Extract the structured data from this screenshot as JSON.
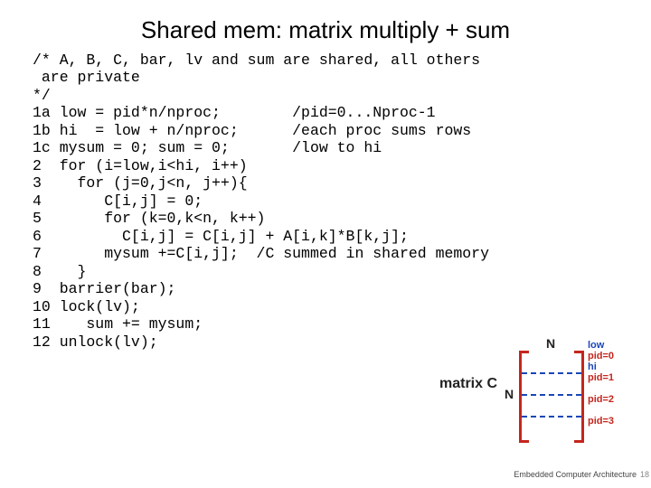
{
  "title": "Shared mem: matrix multiply + sum",
  "code": "/* A, B, C, bar, lv and sum are shared, all others\n are private\n*/\n1a low = pid*n/nproc;        /pid=0...Nproc-1\n1b hi  = low + n/nproc;      /each proc sums rows\n1c mysum = 0; sum = 0;       /low to hi\n2  for (i=low,i<hi, i++)\n3    for (j=0,j<n, j++){\n4       C[i,j] = 0;\n5       for (k=0,k<n, k++)\n6         C[i,j] = C[i,j] + A[i,k]*B[k,j];\n7       mysum +=C[i,j];  /C summed in shared memory\n8    }\n9  barrier(bar);\n10 lock(lv);\n11    sum += mysum;\n12 unlock(lv);",
  "diagram": {
    "label": "matrix C",
    "Ntop": "N",
    "Nside": "N",
    "pids": [
      "pid=0",
      "pid=1",
      "pid=2",
      "pid=3"
    ],
    "low": "low",
    "hi": "hi"
  },
  "footer": "Embedded Computer Architecture",
  "page": "18"
}
